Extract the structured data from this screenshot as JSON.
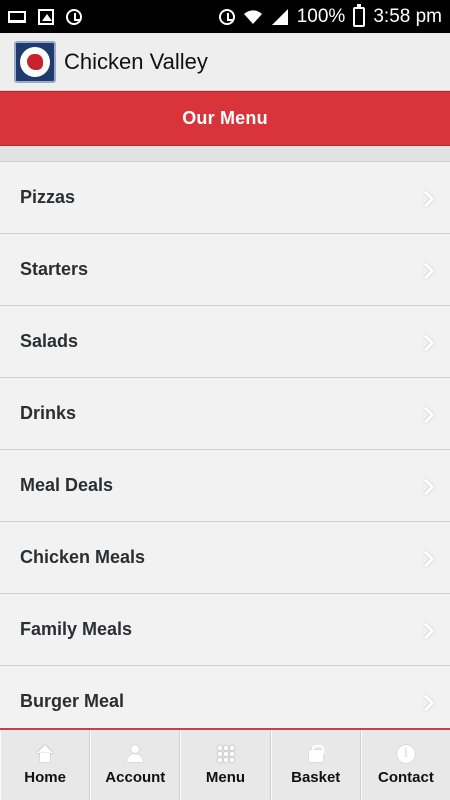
{
  "status_bar": {
    "battery": "100%",
    "time": "3:58 pm"
  },
  "app": {
    "title": "Chicken Valley"
  },
  "header": {
    "title": "Our Menu"
  },
  "menu": {
    "items": [
      {
        "label": "Pizzas"
      },
      {
        "label": "Starters"
      },
      {
        "label": "Salads"
      },
      {
        "label": "Drinks"
      },
      {
        "label": "Meal Deals"
      },
      {
        "label": "Chicken Meals"
      },
      {
        "label": "Family Meals"
      },
      {
        "label": "Burger Meal"
      }
    ]
  },
  "bottom_nav": {
    "items": [
      {
        "label": "Home",
        "icon": "home-icon"
      },
      {
        "label": "Account",
        "icon": "user-icon"
      },
      {
        "label": "Menu",
        "icon": "grid-icon"
      },
      {
        "label": "Basket",
        "icon": "basket-icon"
      },
      {
        "label": "Contact",
        "icon": "info-icon"
      }
    ]
  },
  "colors": {
    "accent": "#d9343a",
    "app_bar": "#eeeeee",
    "list_bg": "#f2f2f2"
  }
}
